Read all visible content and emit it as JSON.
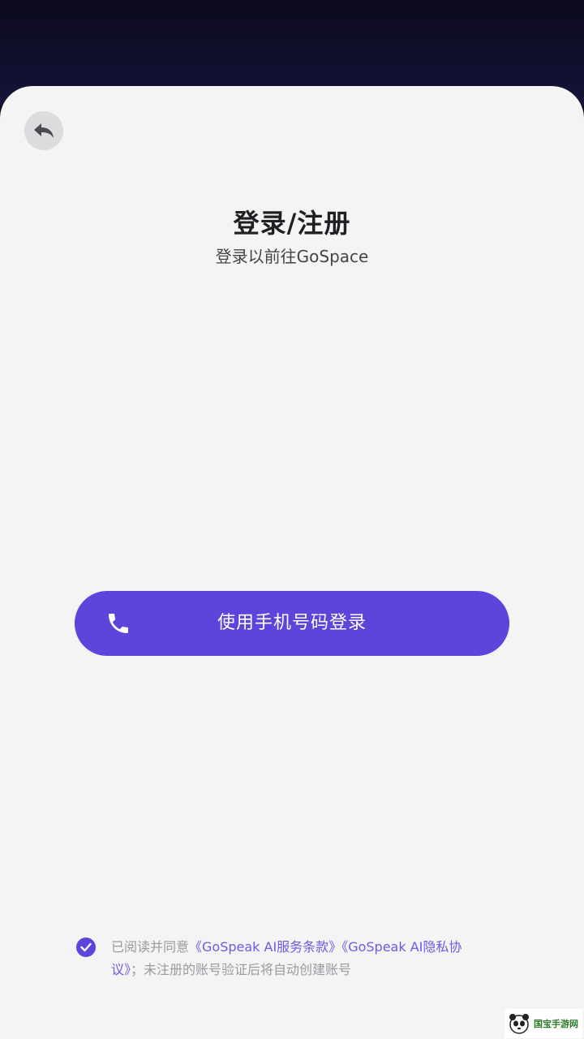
{
  "header": {
    "back_icon": "back-arrow-icon"
  },
  "login": {
    "title": "登录/注册",
    "subtitle": "登录以前往GoSpace",
    "phone_button_label": "使用手机号码登录",
    "phone_icon": "phone-icon"
  },
  "agreement": {
    "checked": true,
    "prefix": "已阅读并同意",
    "terms_link": "《GoSpeak AI服务条款》",
    "privacy_link": "《GoSpeak AI隐私协议》",
    "suffix": "；未注册的账号验证后将自动创建账号"
  },
  "watermark": {
    "text": "国宝手游网"
  },
  "colors": {
    "accent": "#5b45db",
    "link": "#6d5ae3",
    "sheet_bg": "#f4f4f5",
    "top_bg": "#0d0c22"
  }
}
